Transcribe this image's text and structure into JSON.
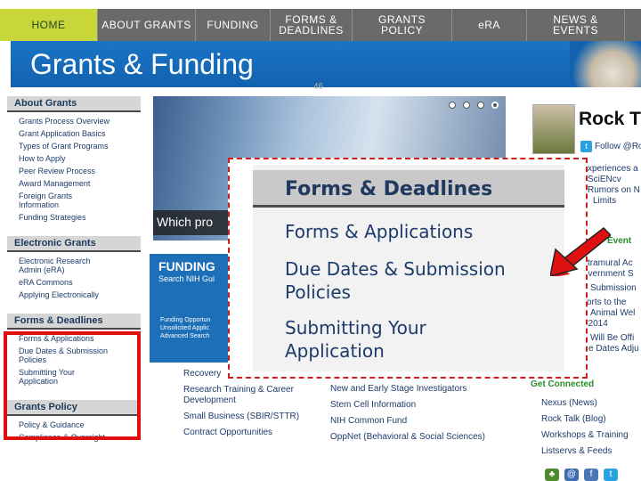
{
  "nav": {
    "items": [
      "HOME",
      "ABOUT GRANTS",
      "FUNDING",
      "FORMS & DEADLINES",
      "GRANTS POLICY",
      "eRA",
      "NEWS & EVENTS"
    ]
  },
  "banner": {
    "title": "Grants & Funding"
  },
  "slide_number": "46",
  "sidebar": {
    "groups": [
      {
        "heading": "About Grants",
        "items": [
          "Grants Process Overview",
          "Grant Application Basics",
          "Types of Grant Programs",
          "How to Apply",
          "Peer Review Process",
          "Award Management",
          "Foreign Grants Information",
          "Funding Strategies"
        ]
      },
      {
        "heading": "Electronic Grants",
        "items": [
          "Electronic Research Admin (eRA)",
          "eRA Commons",
          "Applying Electronically"
        ]
      },
      {
        "heading": "Forms & Deadlines",
        "items": [
          "Forms & Applications",
          "Due Dates & Submission Policies",
          "Submitting Your Application"
        ]
      },
      {
        "heading": "Grants Policy",
        "items": [
          "Policy & Guidance",
          "Compliance & Oversight"
        ]
      }
    ]
  },
  "hero": {
    "caption": "Which pro",
    "slide_count": 4,
    "active_slide": 4
  },
  "funding": {
    "title": "FUNDING",
    "search": "Search NIH Gui",
    "links": [
      "Funding Opportun",
      "Unsolicited Applic",
      "Advanced Search"
    ]
  },
  "center_lists": {
    "left": [
      "Recovery",
      "Research Training & Career Development",
      "Small Business (SBIR/STTR)",
      "Contract Opportunities"
    ],
    "right": [
      "New and Early Stage Investigators",
      "Stem Cell Information",
      "NIH Common Fund",
      "OppNet (Behavioral & Social Sciences)"
    ]
  },
  "right_col": {
    "title": "Rock T",
    "follow": "Follow @Ro",
    "fragments": [
      "xperiences a",
      "SciENcv",
      "Rumors on N",
      "Limits"
    ],
    "events_heading": "Event",
    "events_fragments": [
      "xtramural Ac",
      "overnment S",
      "",
      "Submission",
      "",
      "orts to the",
      "Animal Wel",
      ", 2014",
      "",
      "Will Be Offi",
      "e Dates Adju"
    ],
    "get_connected": "Get Connected",
    "connect_items": [
      "Nexus (News)",
      "Rock Talk (Blog)",
      "Workshops & Training",
      "Listservs & Feeds"
    ]
  },
  "callout": {
    "heading": "Forms & Deadlines",
    "items": [
      "Forms & Applications",
      "Due Dates & Submission Policies",
      "Submitting Your Application"
    ]
  },
  "colors": {
    "nav_bg": "#6a6a6a",
    "home_tab": "#c9d63a",
    "banner_blue": "#1a74c6",
    "highlight_red": "#e01010",
    "link_blue": "#1d3b6a",
    "green": "#2c8c28"
  },
  "icons": [
    "twitter-icon",
    "red-arrow-icon",
    "social-icons"
  ]
}
